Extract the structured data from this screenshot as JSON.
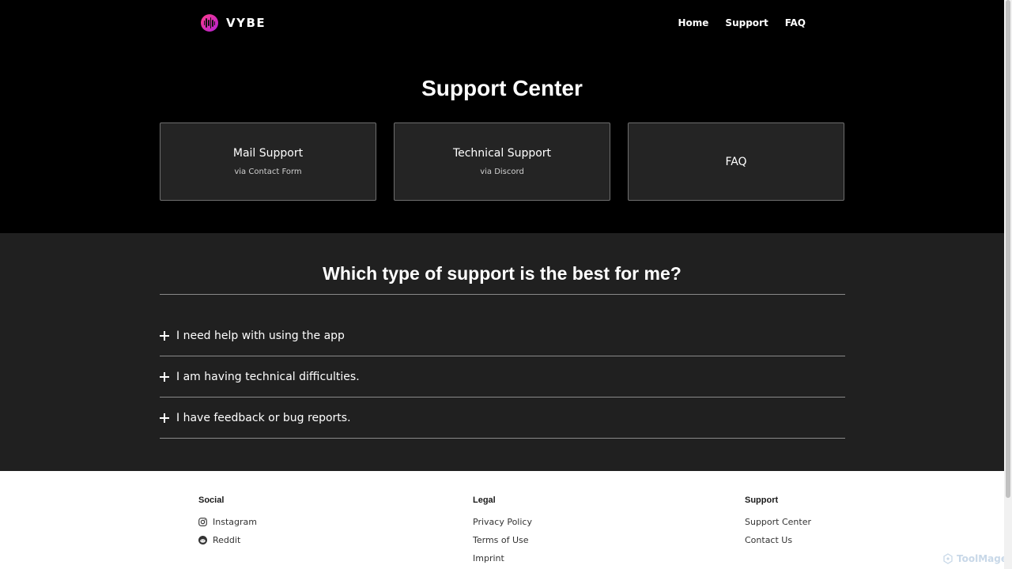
{
  "header": {
    "brand": "VYBE",
    "nav": [
      "Home",
      "Support",
      "FAQ"
    ]
  },
  "hero": {
    "title": "Support Center",
    "cards": [
      {
        "title": "Mail Support",
        "subtitle": "via Contact Form"
      },
      {
        "title": "Technical Support",
        "subtitle": "via Discord"
      },
      {
        "title": "FAQ",
        "subtitle": ""
      }
    ]
  },
  "faq": {
    "title": "Which type of support is the best for me?",
    "items": [
      "I need help with using the app",
      "I am having technical difficulties.",
      "I have feedback or bug reports."
    ]
  },
  "footer": {
    "social": {
      "heading": "Social",
      "links": [
        "Instagram",
        "Reddit"
      ]
    },
    "legal": {
      "heading": "Legal",
      "links": [
        "Privacy Policy",
        "Terms of Use",
        "Imprint"
      ]
    },
    "support": {
      "heading": "Support",
      "links": [
        "Support Center",
        "Contact Us"
      ]
    }
  },
  "watermark": "ToolMage",
  "colors": {
    "background": "#000000",
    "section": "#202020",
    "card": "#242424",
    "accent_start": "#ff3d8a",
    "accent_end": "#b21fd6"
  },
  "icons": {
    "logo": "soundwave-logo-icon",
    "faq_toggle": "plus-icon",
    "instagram": "instagram-icon",
    "reddit": "reddit-icon"
  }
}
